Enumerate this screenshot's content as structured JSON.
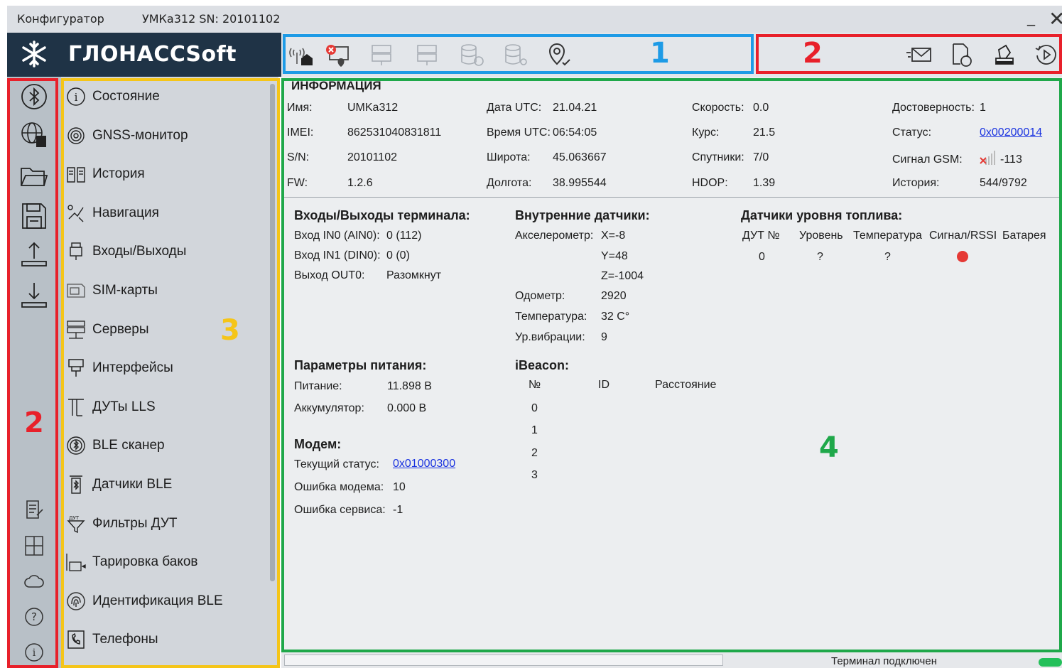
{
  "window": {
    "app_title": "Конфигуратор",
    "device_title": "УМКа312 SN: 20101102",
    "minimize_glyph": "_",
    "close_glyph": "✕"
  },
  "logo": {
    "text": "ГЛОНАССSoft"
  },
  "toolbar": {
    "icons": [
      "antenna-home-icon",
      "card-error-icon",
      "server-1-icon",
      "server-2-icon",
      "database-refresh-icon",
      "database-settings-icon",
      "location-check-icon"
    ],
    "right_icons": [
      "envelope-icon",
      "document-refresh-icon",
      "stamp-icon",
      "history-play-icon"
    ]
  },
  "left_icons": [
    "bluetooth-icon",
    "globe-server-icon",
    "folder-icon",
    "save-icon",
    "upload-icon",
    "download-icon",
    "notes-icon",
    "calculator-icon",
    "cloud-icon",
    "help-icon",
    "info-icon"
  ],
  "nav": {
    "items": [
      {
        "label": "Состояние",
        "icon": "info-circle-icon"
      },
      {
        "label": "GNSS-монитор",
        "icon": "satellite-icon"
      },
      {
        "label": "История",
        "icon": "book-icon"
      },
      {
        "label": "Навигация",
        "icon": "navigation-icon"
      },
      {
        "label": "Входы/Выходы",
        "icon": "io-icon"
      },
      {
        "label": "SIM-карты",
        "icon": "sim-icon"
      },
      {
        "label": "Серверы",
        "icon": "servers-icon"
      },
      {
        "label": "Интерфейсы",
        "icon": "interface-icon"
      },
      {
        "label": "ДУТы LLS",
        "icon": "fuel-sensor-icon"
      },
      {
        "label": "BLE сканер",
        "icon": "ble-scan-icon"
      },
      {
        "label": "Датчики BLE",
        "icon": "ble-sensor-icon"
      },
      {
        "label": "Фильтры ДУТ",
        "icon": "filter-icon"
      },
      {
        "label": "Тарировка баков",
        "icon": "tank-icon"
      },
      {
        "label": "Идентификация BLE",
        "icon": "fingerprint-icon"
      },
      {
        "label": "Телефоны",
        "icon": "phone-icon"
      }
    ]
  },
  "info": {
    "heading": "ИНФОРМАЦИЯ",
    "col1": [
      {
        "label": "Имя:",
        "value": "UMKa312"
      },
      {
        "label": "IMEI:",
        "value": "862531040831811"
      },
      {
        "label": "S/N:",
        "value": "20101102"
      },
      {
        "label": "FW:",
        "value": "1.2.6"
      }
    ],
    "col2": [
      {
        "label": "Дата UTC:",
        "value": "21.04.21"
      },
      {
        "label": "Время UTC:",
        "value": "06:54:05"
      },
      {
        "label": "Широта:",
        "value": "45.063667"
      },
      {
        "label": "Долгота:",
        "value": "38.995544"
      }
    ],
    "col3": [
      {
        "label": "Скорость:",
        "value": "0.0"
      },
      {
        "label": "Курс:",
        "value": "21.5"
      },
      {
        "label": "Спутники:",
        "value": "7/0"
      },
      {
        "label": "HDOP:",
        "value": "1.39"
      }
    ],
    "col4": [
      {
        "label": "Достоверность:",
        "value": "1"
      },
      {
        "label": "Статус:",
        "value": "0x00200014"
      },
      {
        "label": "Сигнал GSM:",
        "value": "-113"
      },
      {
        "label": "История:",
        "value": "544/9792"
      }
    ]
  },
  "io": {
    "heading": "Входы/Выходы терминала:",
    "rows": [
      {
        "label": "Вход IN0 (AIN0):",
        "value": "0 (112)"
      },
      {
        "label": "Вход IN1 (DIN0):",
        "value": "0 (0)"
      },
      {
        "label": "Выход OUT0:",
        "value": "Разомкнут"
      }
    ]
  },
  "sensors": {
    "heading": "Внутренние датчики:",
    "accel_label": "Акселерометр:",
    "accel_x": "X=-8",
    "accel_y": "Y=48",
    "accel_z": "Z=-1004",
    "rows": [
      {
        "label": "Одометр:",
        "value": "2920"
      },
      {
        "label": "Температура:",
        "value": "32 C°"
      },
      {
        "label": "Ур.вибрации:",
        "value": "9"
      }
    ]
  },
  "fuel": {
    "heading": "Датчики уровня топлива:",
    "columns": [
      "ДУТ №",
      "Уровень",
      "Температура",
      "Сигнал/RSSI",
      "Батарея"
    ],
    "row": {
      "num": "0",
      "level": "?",
      "temp": "?",
      "signal_color": "#e53935"
    }
  },
  "power": {
    "heading": "Параметры питания:",
    "rows": [
      {
        "label": "Питание:",
        "value": "11.898 В"
      },
      {
        "label": "Аккумулятор:",
        "value": "0.000 В"
      }
    ]
  },
  "modem": {
    "heading": "Модем:",
    "status_label": "Текущий статус:",
    "status_value": "0x01000300",
    "rows": [
      {
        "label": "Ошибка модема:",
        "value": "10"
      },
      {
        "label": "Ошибка сервиса:",
        "value": "-1"
      }
    ]
  },
  "ibeacon": {
    "heading": "iBeacon:",
    "columns": [
      "№",
      "ID",
      "Расстояние"
    ],
    "rows": [
      "0",
      "1",
      "2",
      "3"
    ]
  },
  "statusbar": {
    "text": "Терминал подключен",
    "led_color": "#24c05a"
  },
  "annotations": {
    "label_1": "1",
    "label_2_top": "2",
    "label_2_left": "2",
    "label_3": "3",
    "label_4": "4",
    "colors": {
      "blue": "#1e9be6",
      "red": "#e8202a",
      "yellow": "#f5c518",
      "green": "#1fa84a"
    }
  }
}
